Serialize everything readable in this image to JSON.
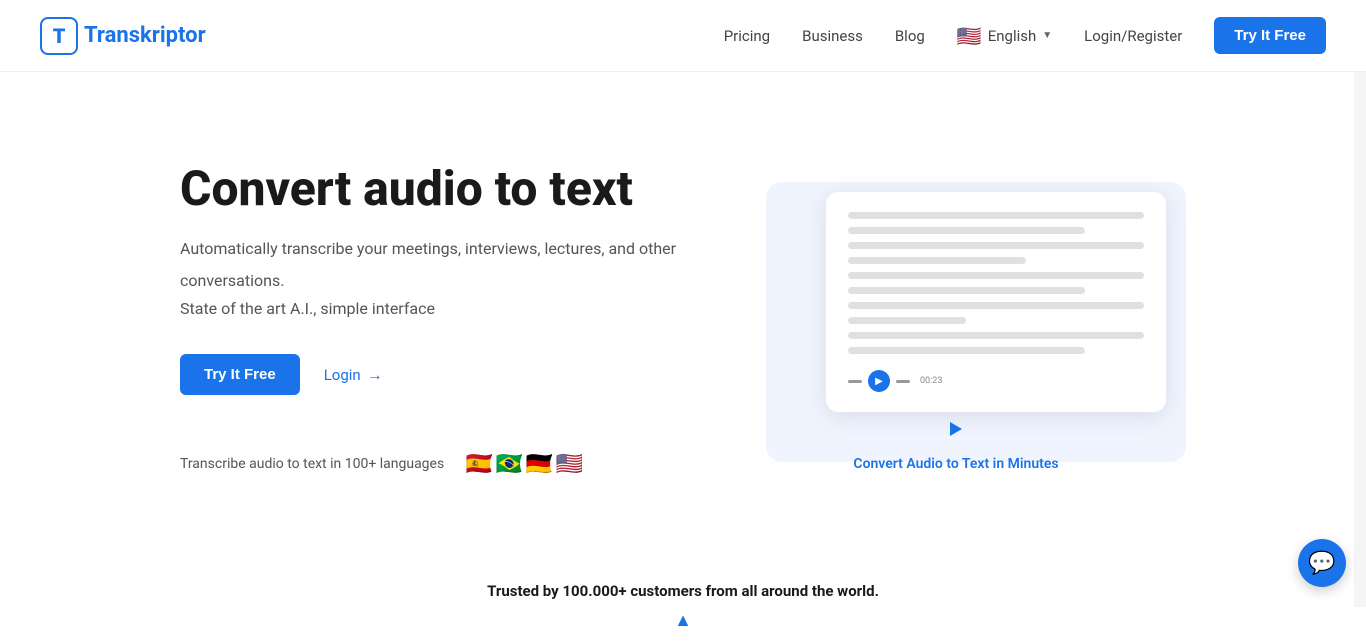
{
  "nav": {
    "logo_letter": "T",
    "logo_name_prefix": "",
    "logo_name": "ranskriptor",
    "links": [
      {
        "id": "pricing",
        "label": "Pricing"
      },
      {
        "id": "business",
        "label": "Business"
      },
      {
        "id": "blog",
        "label": "Blog"
      }
    ],
    "language": "English",
    "flag_emoji": "🇺🇸",
    "login_label": "Login/Register",
    "try_btn_label": "Try It Free"
  },
  "hero": {
    "title": "Convert audio to text",
    "subtitle_line1": "Automatically transcribe your meetings, interviews, lectures, and other",
    "subtitle_line2": "conversations.",
    "ai_line": "State of the art A.I., simple interface",
    "try_btn_label": "Try It Free",
    "login_label": "Login",
    "arrow": "→",
    "lang_label": "Transcribe audio to text in 100+ languages",
    "flags": [
      "🇪🇸",
      "🇧🇷",
      "🇩🇪",
      "🇺🇸"
    ],
    "convert_label": "Convert Audio to Text in Minutes"
  },
  "trusted": {
    "text": "Trusted by 100.000+ customers from all around the world."
  },
  "chat": {
    "icon": "💬"
  }
}
